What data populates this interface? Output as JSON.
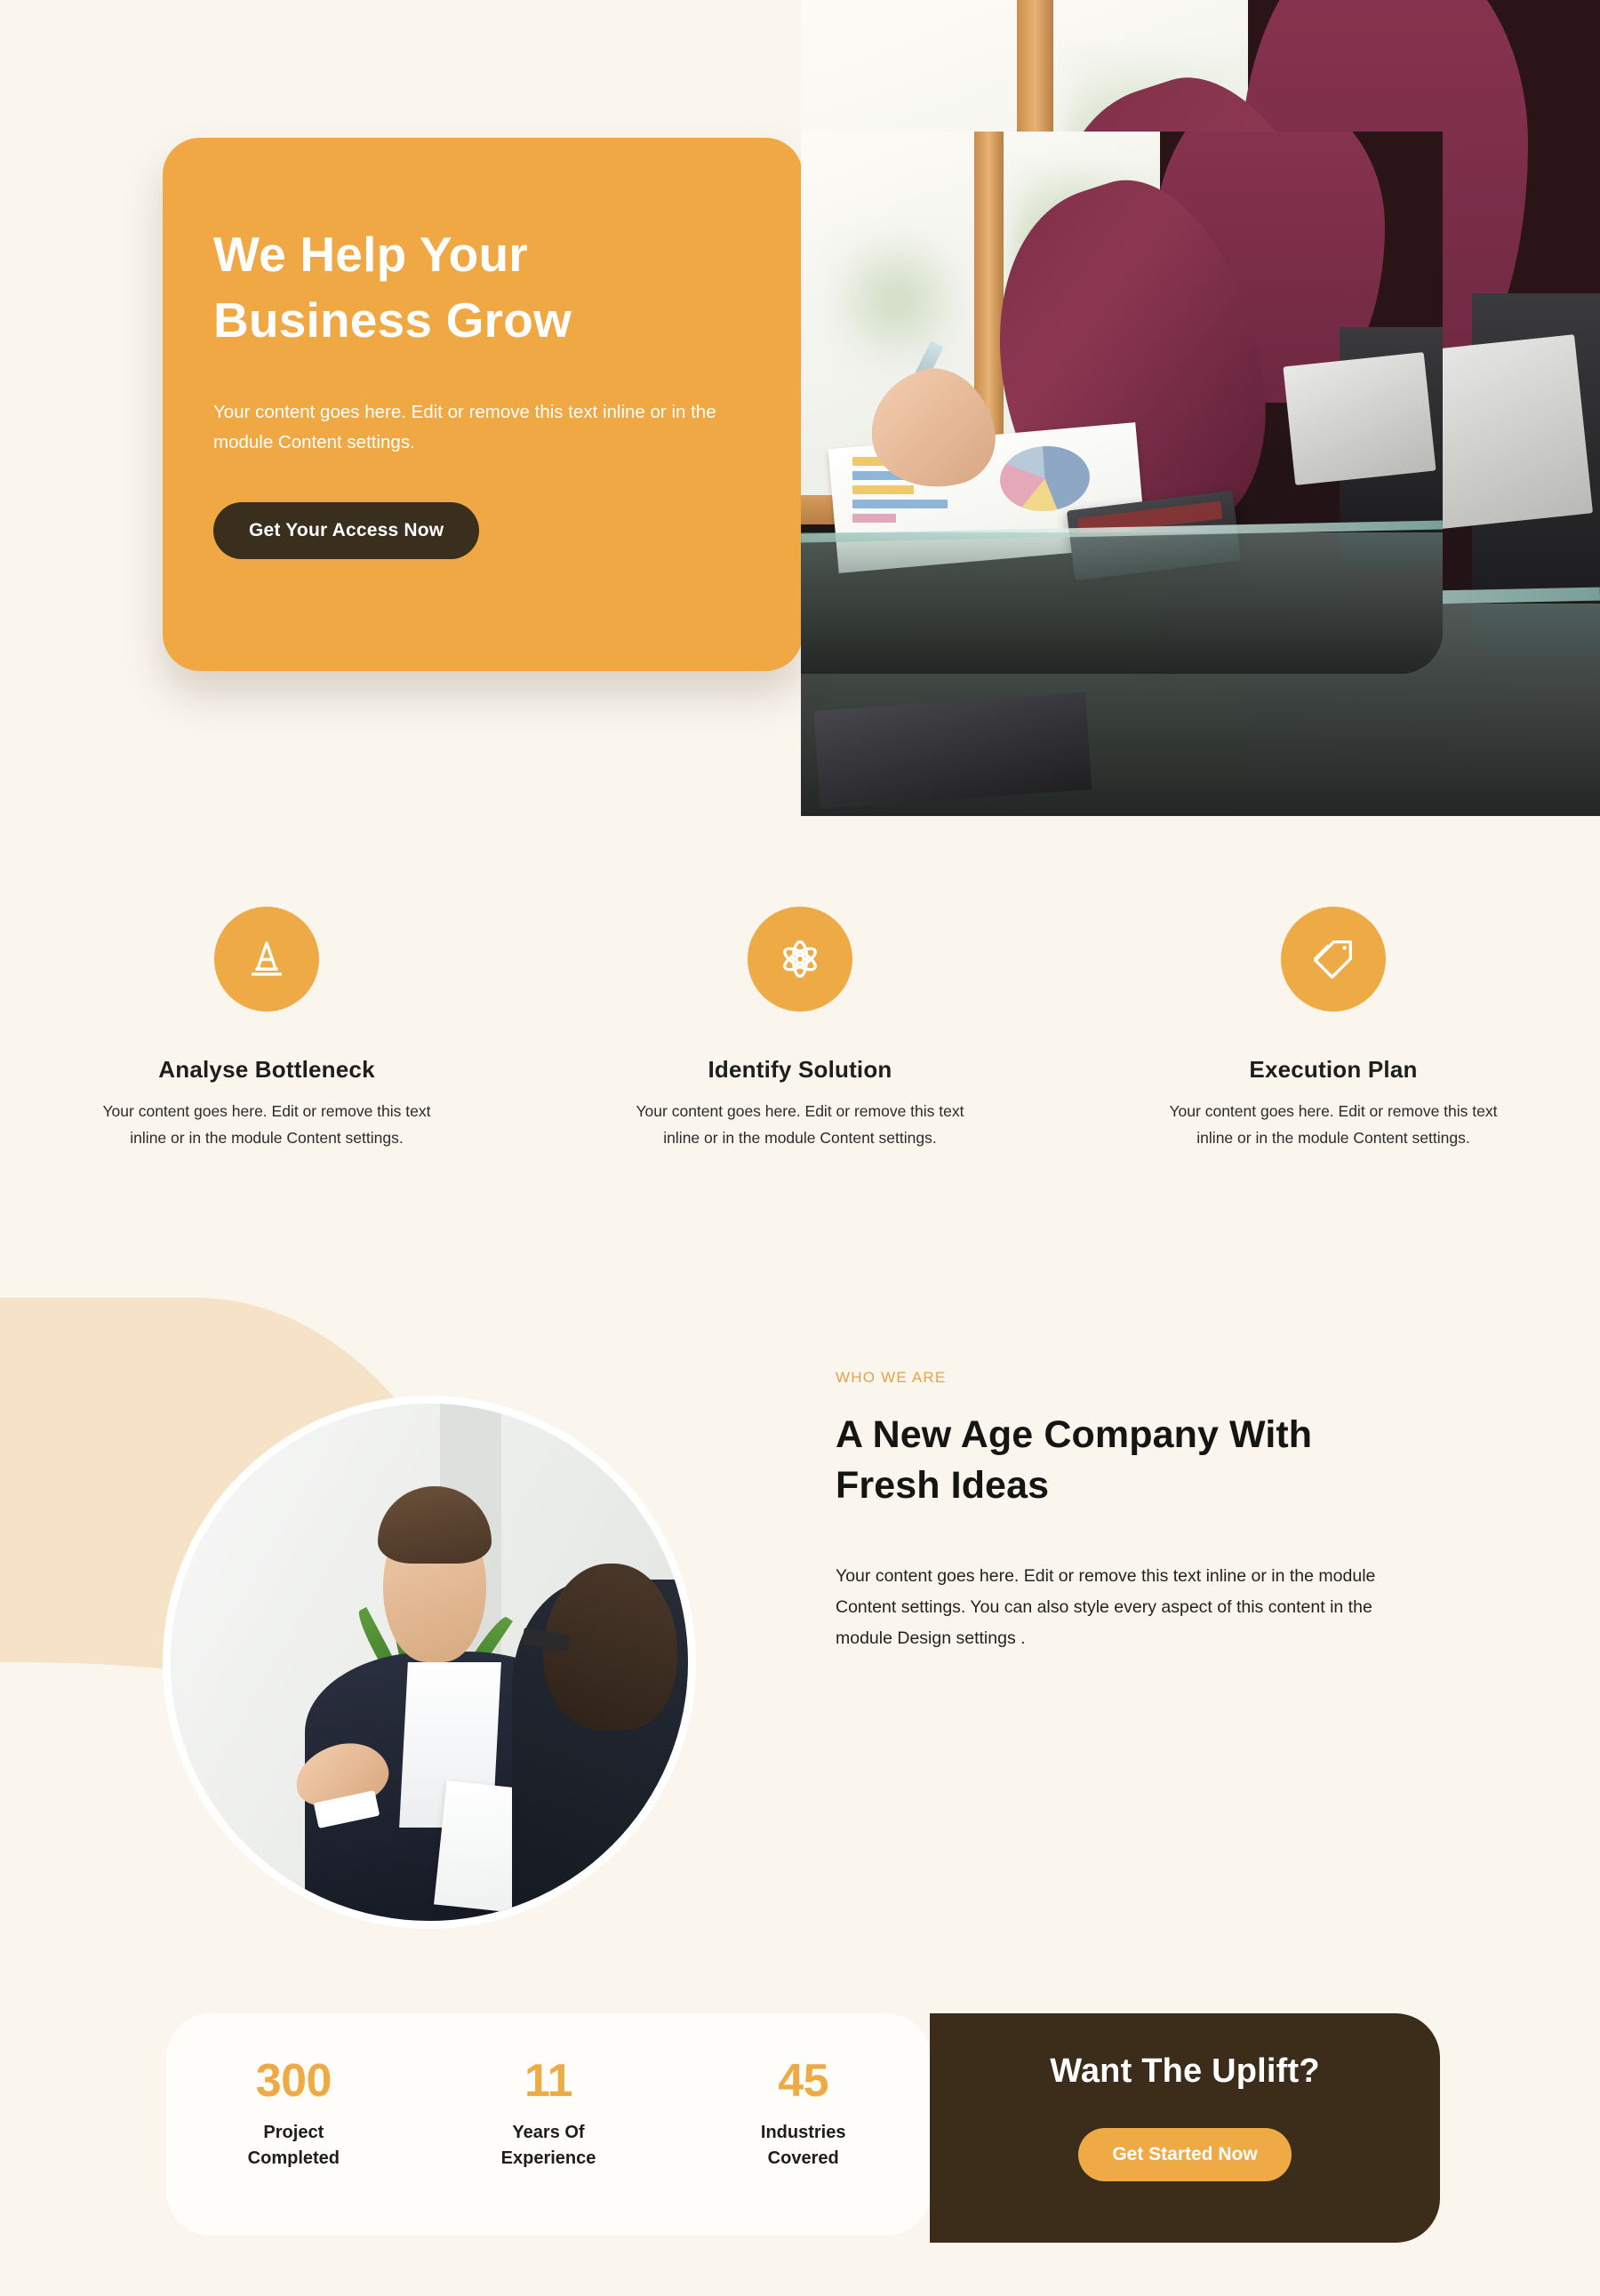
{
  "colors": {
    "page_bg": "#FAF6EE",
    "accent_orange": "#EEAA44",
    "dark_brown": "#3C2D1A",
    "peach_blob": "#F6E2C6",
    "card_white": "#FFFDFA"
  },
  "hero": {
    "title_line1": "We Help Your",
    "title_line2": "Business Grow",
    "subtitle": "Your content goes here. Edit or remove this text inline or in the module Content settings.",
    "cta_label": "Get Your Access Now",
    "background_photo_alt": "businesswoman-writing-on-chart-at-glass-desk",
    "inset_photo_alt": "hand-with-pen-over-report-and-calculator"
  },
  "features": [
    {
      "icon": "traffic-cone-icon",
      "title": "Analyse Bottleneck",
      "text": "Your content goes here. Edit or remove this text inline or in the module Content settings."
    },
    {
      "icon": "atom-icon",
      "title": "Identify Solution",
      "text": "Your content goes here. Edit or remove this text inline or in the module Content settings."
    },
    {
      "icon": "price-tag-icon",
      "title": "Execution Plan",
      "text": "Your content goes here. Edit or remove this text inline or in the module Content settings."
    }
  ],
  "who_we_are": {
    "eyebrow": "WHO WE ARE",
    "title_line1": "A New Age Company With",
    "title_line2": "Fresh Ideas",
    "body": "Your content goes here. Edit or remove this text inline or in the module Content settings. You can also style every aspect of this content in the module Design settings .",
    "photo_alt": "businessman-gesturing-in-meeting-with-colleague"
  },
  "stats": [
    {
      "number": "300",
      "label_line1": "Project",
      "label_line2": "Completed"
    },
    {
      "number": "11",
      "label_line1": "Years Of",
      "label_line2": "Experience"
    },
    {
      "number": "45",
      "label_line1": "Industries",
      "label_line2": "Covered"
    }
  ],
  "cta": {
    "title": "Want The Uplift?",
    "button_label": "Get Started Now"
  }
}
